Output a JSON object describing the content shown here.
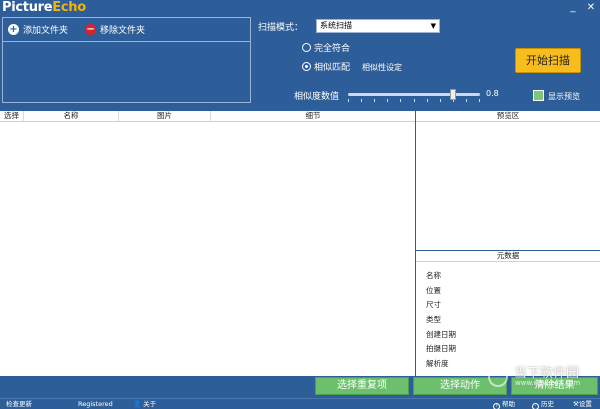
{
  "app": {
    "logo_part1": "Picture",
    "logo_part2": "Echo"
  },
  "window": {
    "minimize": "_",
    "close": "✕"
  },
  "folders": {
    "add_label": "添加文件夹",
    "remove_label": "移除文件夹"
  },
  "scan": {
    "mode_label": "扫描模式：",
    "mode_value": "系统扫描",
    "options": [
      {
        "label": "完全符合",
        "selected": false
      },
      {
        "label": "相似匹配",
        "selected": true
      }
    ],
    "similarity_setting_label": "相似性设定",
    "start_button": "开始扫描",
    "threshold_label": "相似度数值",
    "threshold_value": "0.8",
    "show_preview_label": "显示预览"
  },
  "list": {
    "columns": [
      "选择",
      "名称",
      "图片",
      "细节"
    ]
  },
  "preview": {
    "header": "预览区"
  },
  "metadata": {
    "header": "元数据",
    "fields": [
      "名称",
      "位置",
      "尺寸",
      "类型",
      "创建日期",
      "拍摄日期",
      "解析度"
    ]
  },
  "actions": {
    "select_duplicates": "选择重复项",
    "select_action": "选择动作",
    "clear_results": "清除结果"
  },
  "statusbar": {
    "check_update": "检查更新",
    "registered": "Registered",
    "about": "关于",
    "help": "帮助",
    "history": "历史",
    "settings": "设置"
  },
  "watermark": {
    "line1": "当下软件园",
    "line2": "www.downxia.com"
  },
  "colors": {
    "background": "#2d5e99",
    "scan_button": "#f7bd1e",
    "green_button": "#6cbf6c"
  }
}
